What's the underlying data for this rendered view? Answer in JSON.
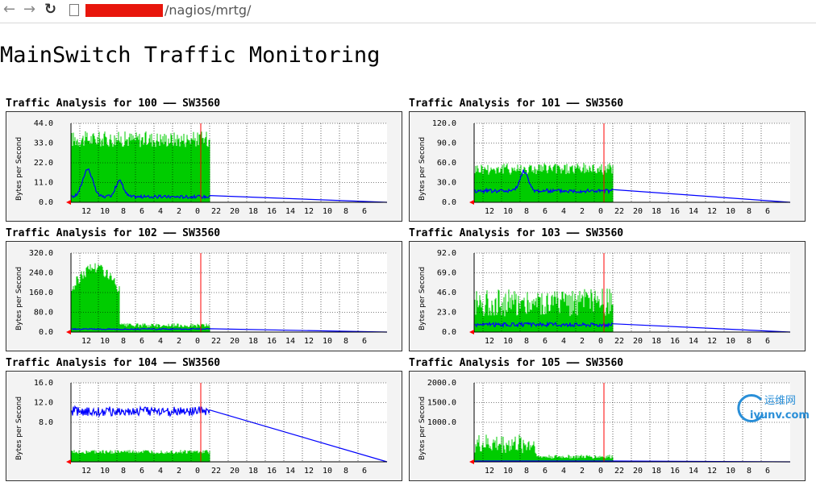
{
  "browser": {
    "back_icon": "←",
    "forward_icon": "→",
    "reload_icon": "↻",
    "url_suffix": "/nagios/mrtg/"
  },
  "page": {
    "title": "MainSwitch Traffic Monitoring"
  },
  "hours": [
    "12",
    "10",
    "8",
    "6",
    "4",
    "2",
    "0",
    "22",
    "20",
    "18",
    "16",
    "14",
    "12",
    "10",
    "8",
    "6"
  ],
  "axis_label": "Bytes per Second",
  "colors": {
    "in": "#00cc00",
    "out": "#0000ff",
    "now_marker": "#ff0000",
    "grid": "#000000"
  },
  "graphs": [
    {
      "title": "Traffic Analysis for 100 —— SW3560",
      "y_ticks": [
        "44.0",
        "33.0",
        "22.0",
        "11.0",
        "0.0"
      ]
    },
    {
      "title": "Traffic Analysis for 101 —— SW3560",
      "y_ticks": [
        "120.0",
        "90.0",
        "60.0",
        "30.0",
        "0.0"
      ]
    },
    {
      "title": "Traffic Analysis for 102 —— SW3560",
      "y_ticks": [
        "320.0",
        "240.0",
        "160.0",
        "80.0",
        "0.0"
      ]
    },
    {
      "title": "Traffic Analysis for 103 —— SW3560",
      "y_ticks": [
        "92.0",
        "69.0",
        "46.0",
        "23.0",
        "0.0"
      ]
    },
    {
      "title": "Traffic Analysis for 104 —— SW3560",
      "y_ticks": [
        "16.0",
        "12.0",
        "8.0"
      ]
    },
    {
      "title": "Traffic Analysis for 105 —— SW3560",
      "y_ticks": [
        "2000.0",
        "1500.0",
        "1000.0"
      ]
    }
  ],
  "watermark": {
    "line1": "运维网",
    "line2": "iyunv.com"
  }
}
